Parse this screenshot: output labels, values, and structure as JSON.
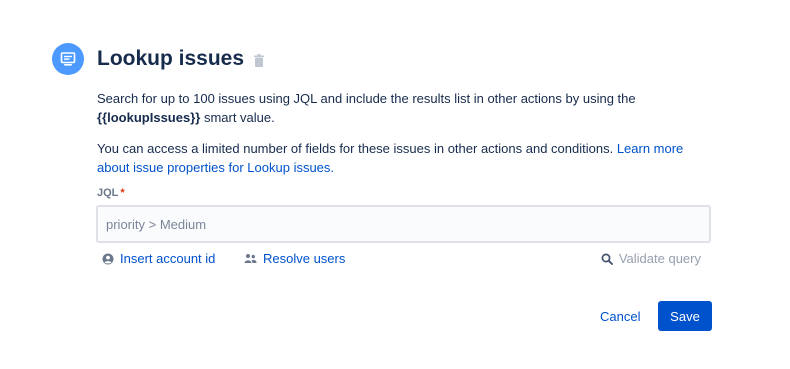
{
  "header": {
    "title": "Lookup issues",
    "icon": "lookup-issues-icon",
    "icon_color": "#4c9aff",
    "delete_icon": "trash-icon"
  },
  "description": {
    "line1_text": "Search for up to 100 issues using JQL and include the results list in other actions by using the ",
    "smart_value": "{{lookupIssues}}",
    "line1_suffix": " smart value.",
    "line2_text": "You can access a limited number of fields for these issues in other actions and conditions. ",
    "line2_link": "Learn more about issue properties for Lookup issues."
  },
  "jql": {
    "label": "JQL",
    "required_marker": "*",
    "placeholder": "priority > Medium"
  },
  "tools": {
    "insert_account_id": "Insert account id",
    "resolve_users": "Resolve users",
    "validate_query": "Validate query"
  },
  "actions": {
    "cancel": "Cancel",
    "save": "Save"
  },
  "colors": {
    "primary": "#0052cc",
    "text": "#172b4d",
    "required": "#de350b"
  }
}
